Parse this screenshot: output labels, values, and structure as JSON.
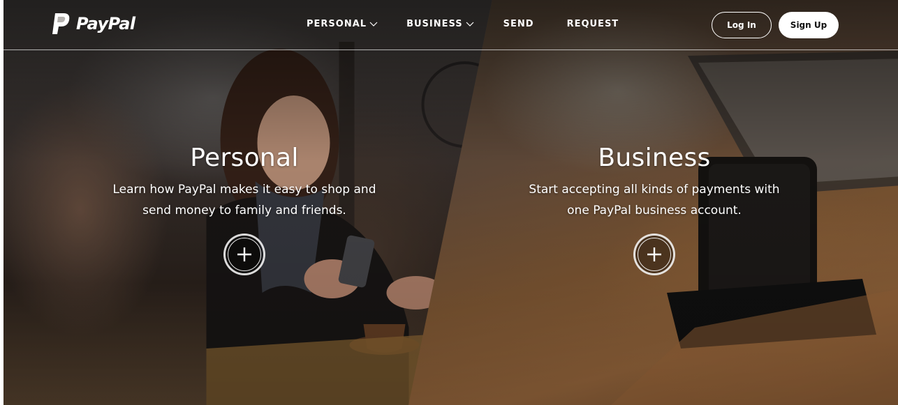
{
  "brand": {
    "name": "PayPal",
    "logo_icon": "paypal-p-icon"
  },
  "nav": {
    "items": [
      {
        "label": "PERSONAL",
        "has_dropdown": true,
        "icon": "chevron-down-icon"
      },
      {
        "label": "BUSINESS",
        "has_dropdown": true,
        "icon": "chevron-down-icon"
      },
      {
        "label": "SEND",
        "has_dropdown": false
      },
      {
        "label": "REQUEST",
        "has_dropdown": false
      }
    ]
  },
  "auth": {
    "login_label": "Log In",
    "signup_label": "Sign Up"
  },
  "hero": {
    "personal": {
      "title": "Personal",
      "desc_line1": "Learn how PayPal makes it easy to shop and",
      "desc_line2": "send money to family and friends.",
      "action_icon": "plus-icon"
    },
    "business": {
      "title": "Business",
      "desc_line1": "Start accepting all kinds of payments with",
      "desc_line2": "one PayPal business account.",
      "action_icon": "plus-icon"
    }
  },
  "colors": {
    "header_text": "#ffffff",
    "signup_bg": "#ffffff",
    "signup_text": "#111111"
  }
}
